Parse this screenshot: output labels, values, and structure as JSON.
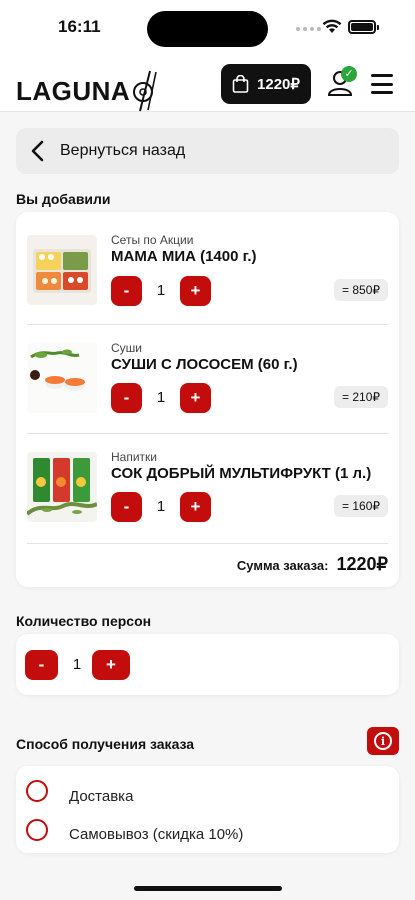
{
  "status_bar": {
    "time": "16:11"
  },
  "header": {
    "logo_text": "LAGUNA",
    "cart_total": "1220₽",
    "colors": {
      "accent": "#c30d0d",
      "dark": "#111111",
      "badge": "#2aa63a"
    }
  },
  "back": {
    "label": "Вернуться назад"
  },
  "added": {
    "title": "Вы добавили",
    "items": [
      {
        "category": "Сеты по Акции",
        "name": "МАМА МИА (1400 г.)",
        "qty": "1",
        "price": "= 850₽",
        "minus": "-",
        "plus": "+"
      },
      {
        "category": "Суши",
        "name": "СУШИ С ЛОСОСЕМ (60 г.)",
        "qty": "1",
        "price": "= 210₽",
        "minus": "-",
        "plus": "+"
      },
      {
        "category": "Напитки",
        "name": "СОК ДОБРЫЙ МУЛЬТИФРУКТ (1 л.)",
        "qty": "1",
        "price": "= 160₽",
        "minus": "-",
        "plus": "+"
      }
    ],
    "sum_label": "Сумма заказа:",
    "sum_value": "1220₽"
  },
  "persons": {
    "title": "Количество персон",
    "qty": "1",
    "minus": "-",
    "plus": "+"
  },
  "delivery": {
    "title": "Способ получения заказа",
    "info_glyph": "i",
    "options": [
      {
        "label": "Доставка"
      },
      {
        "label": "Самовывоз (скидка 10%)"
      }
    ]
  }
}
